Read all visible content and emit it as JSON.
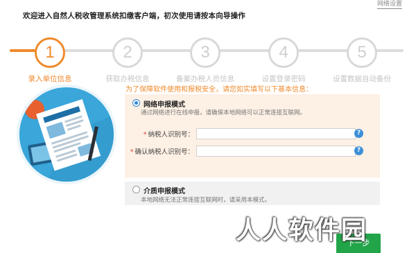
{
  "window": {
    "net_settings": "网络设置",
    "title": "欢迎进入自然人税收管理系统扣缴客户端，初次使用请按本向导操作"
  },
  "steps": [
    {
      "number": "1",
      "label": "录入单位信息",
      "active": true
    },
    {
      "number": "2",
      "label": "获取办税信息",
      "active": false
    },
    {
      "number": "3",
      "label": "备案办税人员信息",
      "active": false
    },
    {
      "number": "4",
      "label": "设置登录密码",
      "active": false
    },
    {
      "number": "5",
      "label": "设置数据自动备份",
      "active": false
    }
  ],
  "prompt": "为了保障软件使用和报税安全，请您如实填写以下基本信息：",
  "network_mode": {
    "title": "网络申报模式",
    "description": "通过网络进行在线申报，请确保本地网络可以正常连接互联网。",
    "selected": true,
    "fields": [
      {
        "label": "纳税人识别号：",
        "value": "",
        "help": "?"
      },
      {
        "label": "确认纳税人识别号：",
        "value": "",
        "help": "?"
      }
    ]
  },
  "media_mode": {
    "title": "介质申报模式",
    "description": "本地网络无法正常连接互联网时，请采用本模式。",
    "selected": false
  },
  "next_button": "下一步",
  "watermark": "人人软件园",
  "colors": {
    "accent": "#f08a2b",
    "inactive": "#d8d8d8",
    "panel_bg": "#fdf0e4",
    "primary_button": "#22a449",
    "help_icon": "#3d8fd8"
  }
}
